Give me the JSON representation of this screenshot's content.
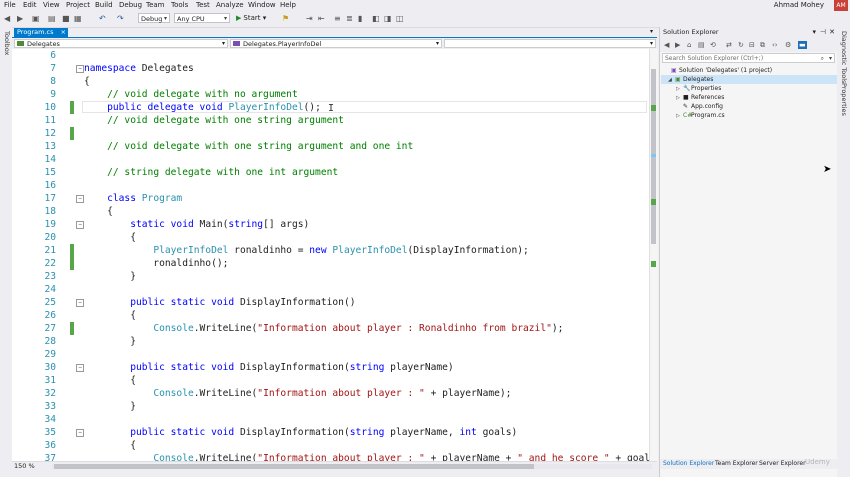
{
  "menu": [
    "File",
    "Edit",
    "View",
    "Project",
    "Build",
    "Debug",
    "Team",
    "Tools",
    "Test",
    "Analyze",
    "Window",
    "Help"
  ],
  "user": {
    "name": "Ahmad Mohey",
    "initials": "AM"
  },
  "toolbar": {
    "config": "Debug",
    "platform": "Any CPU",
    "start": "Start"
  },
  "left_strip": {
    "label": "Toolbox"
  },
  "right_strip": {
    "labels": [
      "Diagnostic Tools",
      "Properties"
    ]
  },
  "editor": {
    "tab": {
      "name": "Program.cs",
      "close": "×"
    },
    "nav": {
      "project": "Delegates",
      "member": "Delegates.PlayerInfoDel",
      "third": ""
    },
    "zoom": "150 %",
    "lines": [
      {
        "n": "6",
        "t": ""
      },
      {
        "n": "7",
        "t": "namespace Delegates"
      },
      {
        "n": "8",
        "t": "{"
      },
      {
        "n": "9",
        "t": "    // void delegate with no argument"
      },
      {
        "n": "10",
        "t": "    public delegate void PlayerInfoDel();"
      },
      {
        "n": "11",
        "t": "    // void delegate with one string argument"
      },
      {
        "n": "12",
        "t": ""
      },
      {
        "n": "13",
        "t": "    // void delegate with one string argument and one int"
      },
      {
        "n": "14",
        "t": ""
      },
      {
        "n": "15",
        "t": "    // string delegate with one int argument"
      },
      {
        "n": "16",
        "t": ""
      },
      {
        "n": "17",
        "t": "    class Program"
      },
      {
        "n": "18",
        "t": "    {"
      },
      {
        "n": "19",
        "t": "        static void Main(string[] args)"
      },
      {
        "n": "20",
        "t": "        {"
      },
      {
        "n": "21",
        "t": "            PlayerInfoDel ronaldinho = new PlayerInfoDel(DisplayInformation);"
      },
      {
        "n": "22",
        "t": "            ronaldinho();"
      },
      {
        "n": "23",
        "t": "        }"
      },
      {
        "n": "24",
        "t": ""
      },
      {
        "n": "25",
        "t": "        public static void DisplayInformation()"
      },
      {
        "n": "26",
        "t": "        {"
      },
      {
        "n": "27",
        "t": "            Console.WriteLine(\"Information about player : Ronaldinho from brazil\");"
      },
      {
        "n": "28",
        "t": "        }"
      },
      {
        "n": "29",
        "t": ""
      },
      {
        "n": "30",
        "t": "        public static void DisplayInformation(string playerName)"
      },
      {
        "n": "31",
        "t": "        {"
      },
      {
        "n": "32",
        "t": "            Console.WriteLine(\"Information about player : \" + playerName);"
      },
      {
        "n": "33",
        "t": "        }"
      },
      {
        "n": "34",
        "t": ""
      },
      {
        "n": "35",
        "t": "        public static void DisplayInformation(string playerName, int goals)"
      },
      {
        "n": "36",
        "t": "        {"
      },
      {
        "n": "37",
        "t": "            Console.WriteLine(\"Information about player : \" + playerName + \" and he score \" + goals);"
      }
    ]
  },
  "solution_explorer": {
    "title": "Solution Explorer",
    "search_placeholder": "Search Solution Explorer (Ctrl+;)",
    "tree": [
      {
        "label": "Solution 'Delegates' (1 project)"
      },
      {
        "label": "Delegates"
      },
      {
        "label": "Properties"
      },
      {
        "label": "References"
      },
      {
        "label": "App.config"
      },
      {
        "label": "Program.cs"
      }
    ],
    "tabs": [
      "Solution Explorer",
      "Team Explorer",
      "Server Explorer"
    ]
  },
  "watermark": "Udemy",
  "colors": {
    "keyword": "#0000ff",
    "type": "#2b91af",
    "comment": "#008000",
    "string": "#a31515",
    "accent": "#007acc",
    "change_bar": "#57a64a"
  }
}
